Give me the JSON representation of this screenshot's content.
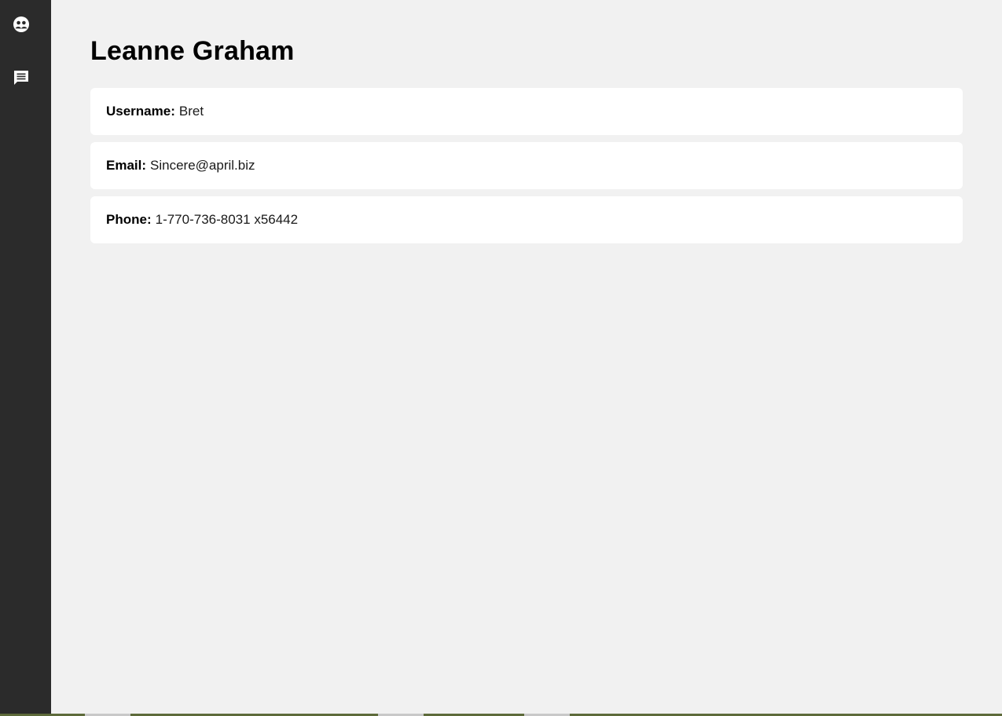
{
  "sidebar": {
    "items": [
      {
        "icon": "users-icon"
      },
      {
        "icon": "message-icon"
      }
    ]
  },
  "user": {
    "name": "Leanne Graham",
    "fields": [
      {
        "label": "Username:",
        "value": "Bret"
      },
      {
        "label": "Email:",
        "value": "Sincere@april.biz"
      },
      {
        "label": "Phone:",
        "value": "1-770-736-8031 x56442"
      }
    ]
  },
  "colors": {
    "sidebar": "#2b2b2b",
    "background": "#f1f1f1",
    "card": "#ffffff"
  }
}
